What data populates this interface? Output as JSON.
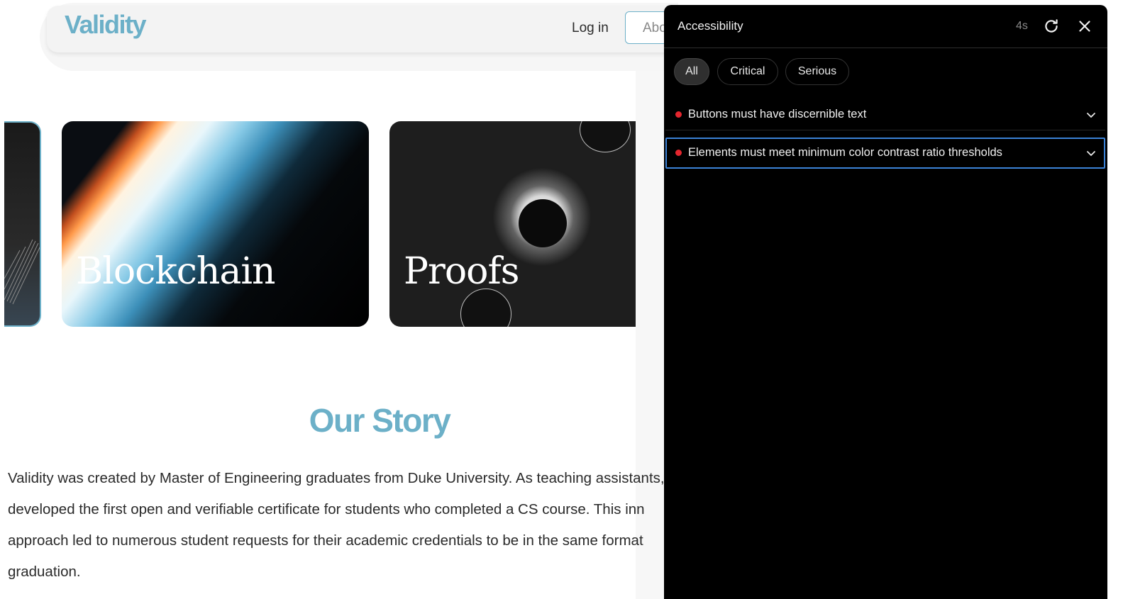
{
  "site": {
    "logo": "Validity",
    "nav": {
      "login": "Log in",
      "about": "About"
    },
    "cards": [
      {
        "title": ""
      },
      {
        "title": "Blockchain"
      },
      {
        "title": "Proofs"
      }
    ],
    "story": {
      "title": "Our Story",
      "lines": [
        "Validity was created by Master of Engineering graduates from Duke University. As teaching assistants,",
        "developed the first open and verifiable certificate for students who completed a CS course. This inn",
        "approach led to numerous student requests for their academic credentials to be in the same format",
        "graduation."
      ]
    },
    "colors": {
      "brand": "#6cb0c8"
    }
  },
  "panel": {
    "title": "Accessibility",
    "timer": "4s",
    "icons": {
      "refresh": "refresh-icon",
      "close": "close-icon"
    },
    "filters": [
      {
        "label": "All",
        "active": true
      },
      {
        "label": "Critical",
        "active": false
      },
      {
        "label": "Serious",
        "active": false
      }
    ],
    "issues": [
      {
        "text": "Buttons must have discernible text",
        "selected": false
      },
      {
        "text": "Elements must meet minimum color contrast ratio thresholds",
        "selected": true
      }
    ],
    "colors": {
      "background": "#000000",
      "severity": "#e5262e",
      "focus": "#3b82d6"
    }
  }
}
